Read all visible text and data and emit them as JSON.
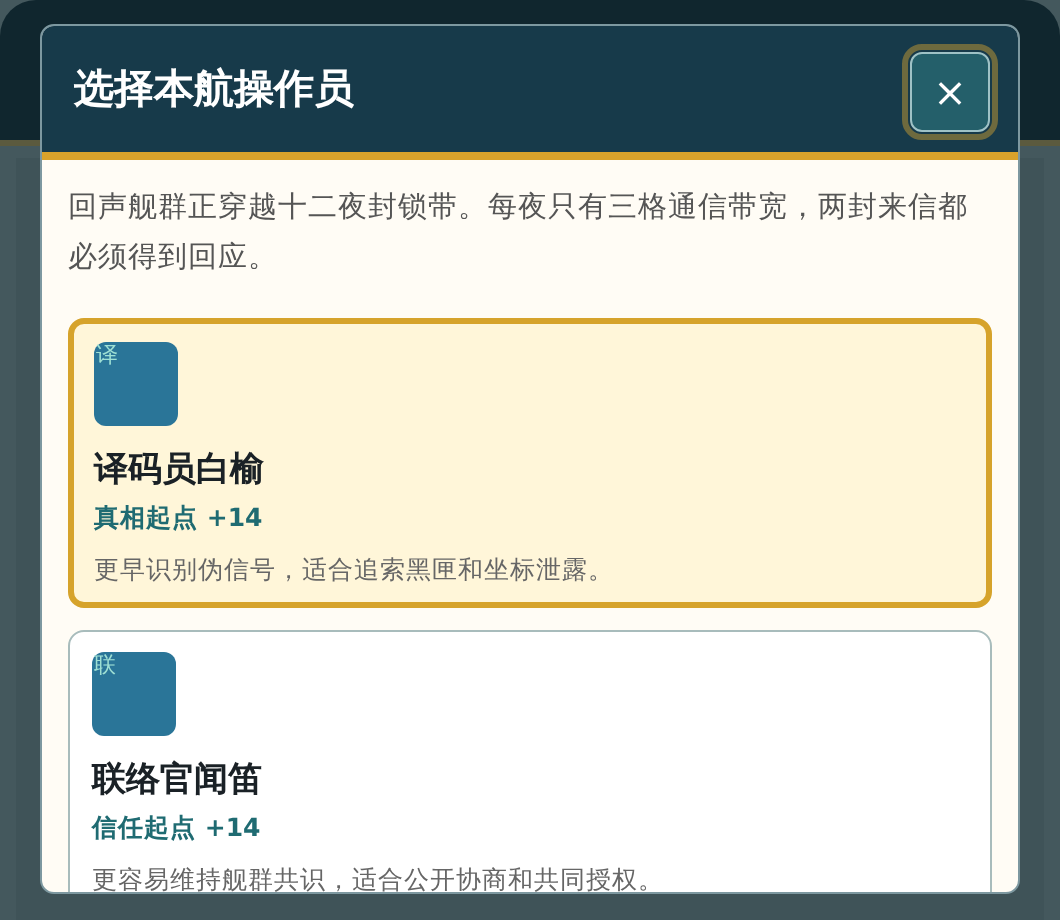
{
  "dialog": {
    "title": "选择本航操作员",
    "close_label": "×",
    "intro": "回声舰群正穿越十二夜封锁带。每夜只有三格通信带宽，两封来信都必须得到回应。",
    "options": [
      {
        "avatar_glyph": "译",
        "name": "译码员白榆",
        "stat": "真相起点 +14",
        "description": "更早识别伪信号，适合追索黑匣和坐标泄露。",
        "selected": true
      },
      {
        "avatar_glyph": "联",
        "name": "联络官闻笛",
        "stat": "信任起点 +14",
        "description": "更容易维持舰群共识，适合公开协商和共同授权。",
        "selected": false
      }
    ]
  }
}
